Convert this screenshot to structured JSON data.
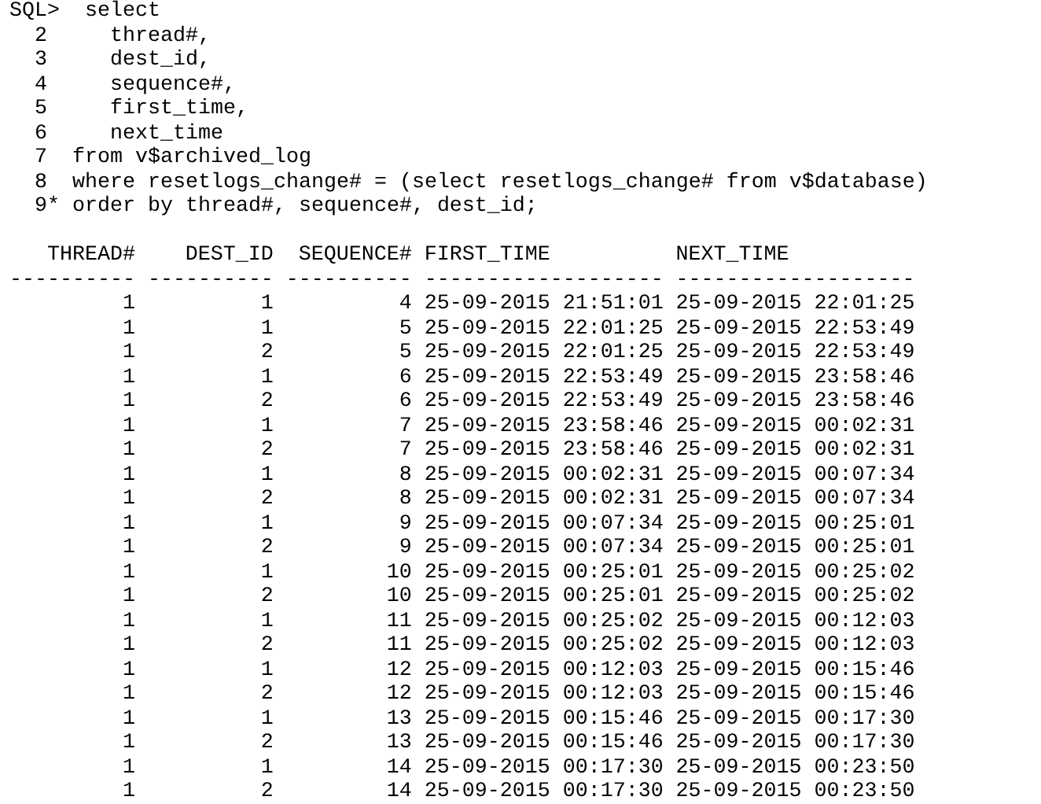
{
  "query_lines": [
    "SQL>  select",
    "  2     thread#,",
    "  3     dest_id,",
    "  4     sequence#,",
    "  5     first_time,",
    "  6     next_time",
    "  7  from v$archived_log",
    "  8  where resetlogs_change# = (select resetlogs_change# from v$database)",
    "  9* order by thread#, sequence#, dest_id;"
  ],
  "table": {
    "columns": [
      "THREAD#",
      "DEST_ID",
      "SEQUENCE#",
      "FIRST_TIME",
      "NEXT_TIME"
    ],
    "separators": [
      "----------",
      "----------",
      "----------",
      "-------------------",
      "-------------------"
    ],
    "rows": [
      [
        "1",
        "1",
        "4",
        "25-09-2015 21:51:01",
        "25-09-2015 22:01:25"
      ],
      [
        "1",
        "1",
        "5",
        "25-09-2015 22:01:25",
        "25-09-2015 22:53:49"
      ],
      [
        "1",
        "2",
        "5",
        "25-09-2015 22:01:25",
        "25-09-2015 22:53:49"
      ],
      [
        "1",
        "1",
        "6",
        "25-09-2015 22:53:49",
        "25-09-2015 23:58:46"
      ],
      [
        "1",
        "2",
        "6",
        "25-09-2015 22:53:49",
        "25-09-2015 23:58:46"
      ],
      [
        "1",
        "1",
        "7",
        "25-09-2015 23:58:46",
        "25-09-2015 00:02:31"
      ],
      [
        "1",
        "2",
        "7",
        "25-09-2015 23:58:46",
        "25-09-2015 00:02:31"
      ],
      [
        "1",
        "1",
        "8",
        "25-09-2015 00:02:31",
        "25-09-2015 00:07:34"
      ],
      [
        "1",
        "2",
        "8",
        "25-09-2015 00:02:31",
        "25-09-2015 00:07:34"
      ],
      [
        "1",
        "1",
        "9",
        "25-09-2015 00:07:34",
        "25-09-2015 00:25:01"
      ],
      [
        "1",
        "2",
        "9",
        "25-09-2015 00:07:34",
        "25-09-2015 00:25:01"
      ],
      [
        "1",
        "1",
        "10",
        "25-09-2015 00:25:01",
        "25-09-2015 00:25:02"
      ],
      [
        "1",
        "2",
        "10",
        "25-09-2015 00:25:01",
        "25-09-2015 00:25:02"
      ],
      [
        "1",
        "1",
        "11",
        "25-09-2015 00:25:02",
        "25-09-2015 00:12:03"
      ],
      [
        "1",
        "2",
        "11",
        "25-09-2015 00:25:02",
        "25-09-2015 00:12:03"
      ],
      [
        "1",
        "1",
        "12",
        "25-09-2015 00:12:03",
        "25-09-2015 00:15:46"
      ],
      [
        "1",
        "2",
        "12",
        "25-09-2015 00:12:03",
        "25-09-2015 00:15:46"
      ],
      [
        "1",
        "1",
        "13",
        "25-09-2015 00:15:46",
        "25-09-2015 00:17:30"
      ],
      [
        "1",
        "2",
        "13",
        "25-09-2015 00:15:46",
        "25-09-2015 00:17:30"
      ],
      [
        "1",
        "1",
        "14",
        "25-09-2015 00:17:30",
        "25-09-2015 00:23:50"
      ],
      [
        "1",
        "2",
        "14",
        "25-09-2015 00:17:30",
        "25-09-2015 00:23:50"
      ]
    ]
  }
}
